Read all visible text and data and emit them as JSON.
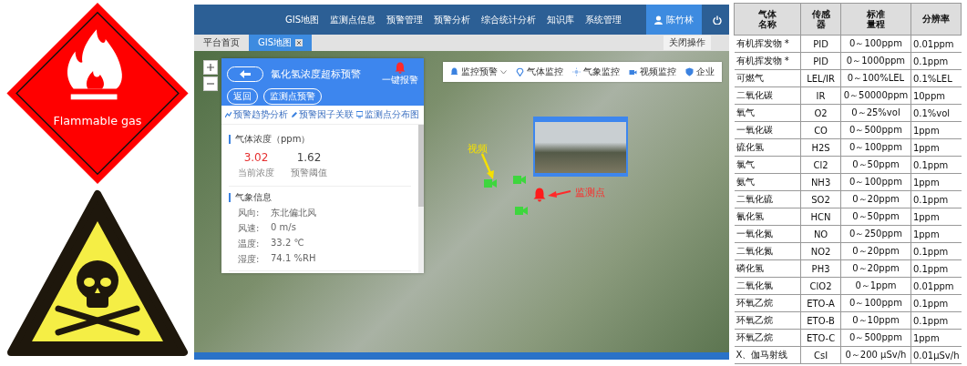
{
  "hazard_signs": [
    {
      "kind": "flammable",
      "label": "Flammable gas"
    },
    {
      "kind": "toxic"
    }
  ],
  "app": {
    "nav": [
      {
        "label": "GIS地图"
      },
      {
        "label": "监测点信息"
      },
      {
        "label": "预警管理"
      },
      {
        "label": "预警分析"
      },
      {
        "label": "综合统计分析"
      },
      {
        "label": "知识库"
      },
      {
        "label": "系统管理"
      }
    ],
    "user": "陈竹林",
    "tabs": [
      {
        "label": "平台首页",
        "selected": false
      },
      {
        "label": "GIS地图",
        "selected": true
      }
    ],
    "close_button": "关闭操作",
    "panel": {
      "title": "氯化氢浓度超标预警",
      "alarm_button": "一键报警",
      "buttons": [
        "返回",
        "监测点预警"
      ],
      "links": [
        {
          "kind": "trend",
          "label": "预警趋势分析"
        },
        {
          "kind": "link",
          "label": "预警因子关联"
        },
        {
          "kind": "map",
          "label": "监测点分布图"
        }
      ],
      "gas": {
        "title": "气体浓度",
        "unit": "（ppm）",
        "values": [
          {
            "value": "3.02",
            "caption": "当前浓度",
            "alert": true
          },
          {
            "value": "1.62",
            "caption": "预警阈值",
            "alert": false
          }
        ]
      },
      "weather": {
        "title": "气象信息",
        "rows": [
          {
            "label": "风向:",
            "value": "东北偏北风"
          },
          {
            "label": "风速:",
            "value": "0 m/s"
          },
          {
            "label": "温度:",
            "value": "33.2 ℃"
          },
          {
            "label": "湿度:",
            "value": "74.1 %RH"
          }
        ]
      }
    },
    "toolbar": [
      {
        "kind": "bell",
        "label": "监控预警",
        "dropdown": true
      },
      {
        "kind": "pin",
        "label": "气体监控",
        "dropdown": false
      },
      {
        "kind": "sun",
        "label": "气象监控",
        "dropdown": false
      },
      {
        "kind": "camera",
        "label": "视频监控",
        "dropdown": false
      },
      {
        "kind": "shield",
        "label": "企业",
        "dropdown": false
      }
    ],
    "map_labels": {
      "video": "视频",
      "monitor": "监测点"
    }
  },
  "table": {
    "columns": [
      "气体名称",
      "传感器",
      "标准量程",
      "分辨率"
    ],
    "rows": [
      [
        "有机挥发物 *",
        "PID",
        "0～100ppm",
        "0.01ppm"
      ],
      [
        "有机挥发物 *",
        "PID",
        "0～1000ppm",
        "0.1ppm"
      ],
      [
        "可燃气",
        "LEL/IR",
        "0～100%LEL",
        "0.1%LEL"
      ],
      [
        "二氧化碳",
        "IR",
        "0～50000ppm",
        "10ppm"
      ],
      [
        "氧气",
        "O2",
        "0～25%vol",
        "0.1%vol"
      ],
      [
        "一氧化碳",
        "CO",
        "0～500ppm",
        "1ppm"
      ],
      [
        "硫化氢",
        "H2S",
        "0～100ppm",
        "1ppm"
      ],
      [
        "氯气",
        "Cl2",
        "0～50ppm",
        "0.1ppm"
      ],
      [
        "氨气",
        "NH3",
        "0～100ppm",
        "1ppm"
      ],
      [
        "二氧化硫",
        "SO2",
        "0～20ppm",
        "0.1ppm"
      ],
      [
        "氰化氢",
        "HCN",
        "0～50ppm",
        "1ppm"
      ],
      [
        "一氧化氮",
        "NO",
        "0～250ppm",
        "1ppm"
      ],
      [
        "二氧化氮",
        "NO2",
        "0～20ppm",
        "0.1ppm"
      ],
      [
        "磷化氢",
        "PH3",
        "0～20ppm",
        "0.1ppm"
      ],
      [
        "二氧化氯",
        "ClO2",
        "0～1ppm",
        "0.01ppm"
      ],
      [
        "环氧乙烷",
        "ETO-A",
        "0～100ppm",
        "0.1ppm"
      ],
      [
        "环氧乙烷",
        "ETO-B",
        "0～10ppm",
        "0.1ppm"
      ],
      [
        "环氧乙烷",
        "ETO-C",
        "0～500ppm",
        "1ppm"
      ],
      [
        "X、伽马射线",
        "CsI",
        "0～200 μSv/h",
        "0.01μSv/h"
      ]
    ]
  }
}
